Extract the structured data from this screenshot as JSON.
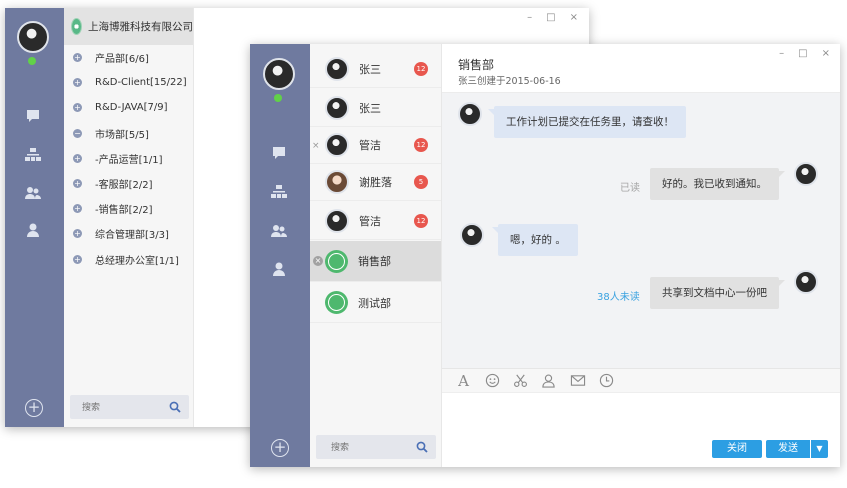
{
  "window_controls": {
    "minimize": "–",
    "maximize": "□",
    "close": "×"
  },
  "back_window": {
    "org_name": "上海博雅科技有限公司",
    "departments": [
      {
        "toggle": "+",
        "label": "产品部[6/6]"
      },
      {
        "toggle": "+",
        "label": "R&D-Client[15/22]"
      },
      {
        "toggle": "+",
        "label": "R&D-JAVA[7/9]"
      },
      {
        "toggle": "−",
        "label": "市场部[5/5]"
      },
      {
        "toggle": "+",
        "label": "-产品运营[1/1]"
      },
      {
        "toggle": "+",
        "label": "-客服部[2/2]"
      },
      {
        "toggle": "+",
        "label": "-销售部[2/2]"
      },
      {
        "toggle": "+",
        "label": "综合管理部[3/3]"
      },
      {
        "toggle": "+",
        "label": "总经理办公室[1/1]"
      }
    ],
    "search_placeholder": "搜索"
  },
  "front_window": {
    "contacts": [
      {
        "name": "张三",
        "badge": "12"
      },
      {
        "name": "张三",
        "badge": ""
      },
      {
        "name": "管洁",
        "badge": "12",
        "remove": "×"
      },
      {
        "name": "谢胜落",
        "badge": "5"
      },
      {
        "name": "管洁",
        "badge": "12"
      },
      {
        "name": "销售部",
        "badge": "",
        "remove": "×"
      },
      {
        "name": "测试部",
        "badge": ""
      }
    ],
    "search_placeholder": "搜索",
    "chat": {
      "title": "销售部",
      "subtitle": "张三创建于2015-06-16",
      "messages": [
        {
          "text": "工作计划已提交在任务里，请查收！"
        },
        {
          "text": "好的。我已收到通知。",
          "status": "已读"
        },
        {
          "text": "嗯，好的 。"
        },
        {
          "text": "共享到文档中心一份吧",
          "status": "38人未读"
        }
      ],
      "toolbar_font": "A",
      "close_label": "关闭",
      "send_label": "发送",
      "send_arrow": "▼"
    }
  },
  "colors": {
    "rail": "#6f7a9f",
    "accent": "#2c9ee3",
    "badge": "#e8574e",
    "online": "#61d148"
  }
}
